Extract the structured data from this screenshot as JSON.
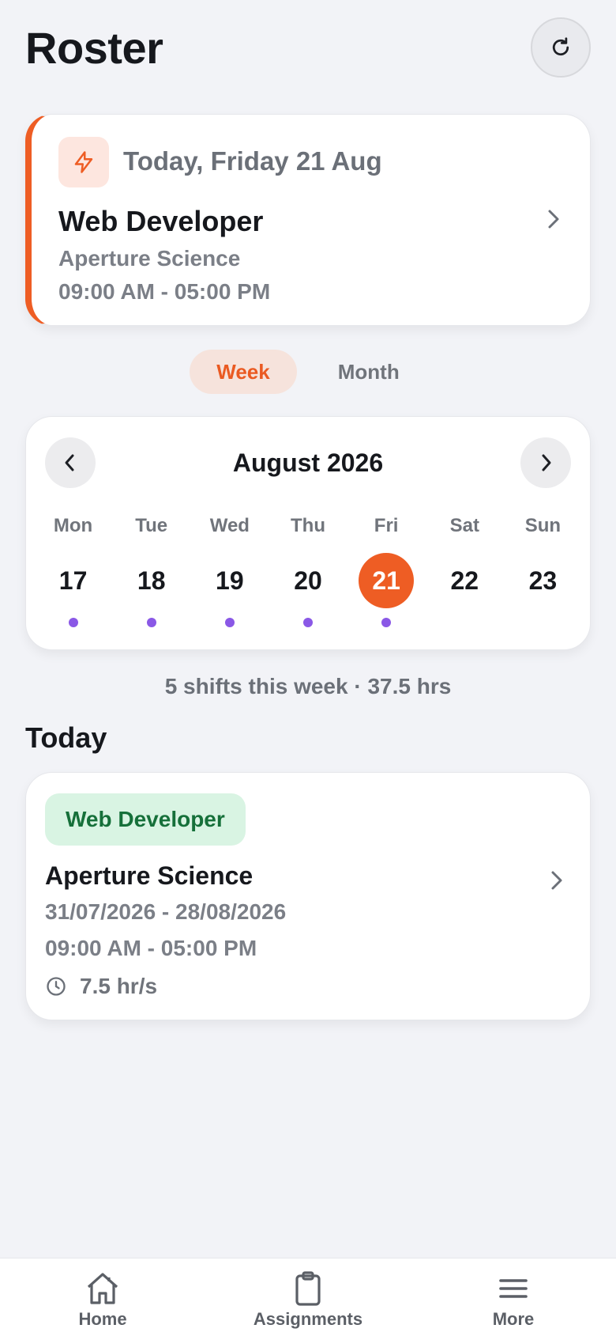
{
  "header": {
    "title": "Roster",
    "refresh_icon": "refresh-icon"
  },
  "today_card": {
    "date_label": "Today, Friday 21 Aug",
    "role": "Web Developer",
    "company": "Aperture Science",
    "time": "09:00 AM - 05:00 PM",
    "accent_color": "#ee5d24"
  },
  "view_toggle": {
    "week_label": "Week",
    "month_label": "Month",
    "active": "Week"
  },
  "calendar": {
    "month_title": "August 2026",
    "days": [
      {
        "dow": "Mon",
        "num": "17",
        "has_shift": true
      },
      {
        "dow": "Tue",
        "num": "18",
        "has_shift": true
      },
      {
        "dow": "Wed",
        "num": "19",
        "has_shift": true
      },
      {
        "dow": "Thu",
        "num": "20",
        "has_shift": true
      },
      {
        "dow": "Fri",
        "num": "21",
        "has_shift": true,
        "selected": true
      },
      {
        "dow": "Sat",
        "num": "22",
        "has_shift": false
      },
      {
        "dow": "Sun",
        "num": "23",
        "has_shift": false
      }
    ],
    "selected_color": "#ee5d24",
    "dot_color": "#8a58e6"
  },
  "summary": "5 shifts this week · 37.5 hrs",
  "today_section": {
    "title": "Today",
    "shift": {
      "role_badge": "Web Developer",
      "company": "Aperture Science",
      "date_range": "31/07/2026 - 28/08/2026",
      "time": "09:00 AM - 05:00 PM",
      "hours": "7.5 hr/s"
    }
  },
  "bottom_nav": {
    "items": [
      {
        "label": "Home",
        "icon": "home-icon"
      },
      {
        "label": "Assignments",
        "icon": "clipboard-icon"
      },
      {
        "label": "More",
        "icon": "menu-icon"
      }
    ]
  }
}
